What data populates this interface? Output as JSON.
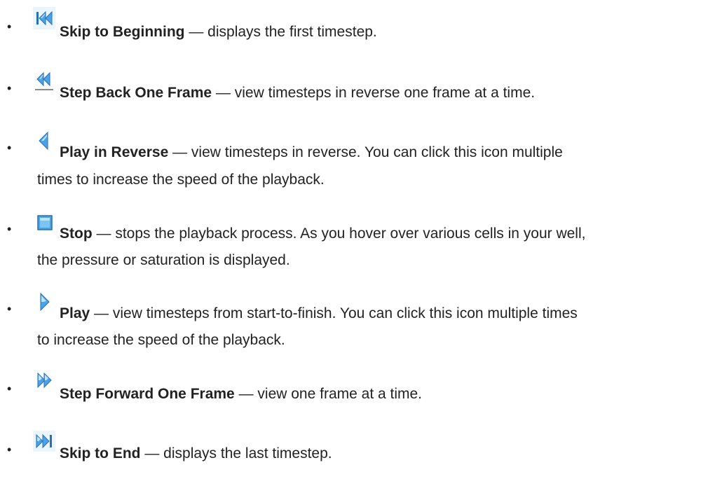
{
  "items": [
    {
      "icon": "skip-to-beginning-icon",
      "term": "Skip to Beginning",
      "desc": " — displays the first timestep.",
      "desc_cont": ""
    },
    {
      "icon": "step-back-one-frame-icon",
      "term": "Step Back One Frame",
      "desc": " — view timesteps in reverse one frame at a time.",
      "desc_cont": ""
    },
    {
      "icon": "play-in-reverse-icon",
      "term": "Play in Reverse",
      "desc": " — view timesteps in reverse. You can click this icon multiple",
      "desc_cont": "times to increase the speed of the playback."
    },
    {
      "icon": "stop-icon",
      "term": "Stop",
      "desc": " — stops the playback process. As you hover over various cells in your well,",
      "desc_cont": "the pressure or saturation is displayed."
    },
    {
      "icon": "play-icon",
      "term": "Play",
      "desc": " — view timesteps from start-to-finish. You can click this icon multiple times",
      "desc_cont": "to increase the speed of the playback."
    },
    {
      "icon": "step-forward-one-frame-icon",
      "term": "Step Forward One Frame",
      "desc": " — view one frame at a time.",
      "desc_cont": ""
    },
    {
      "icon": "skip-to-end-icon",
      "term": "Skip to End",
      "desc": " — displays the last timestep.",
      "desc_cont": ""
    }
  ],
  "bullet_char": "•",
  "colors": {
    "icon_fill": "#4aa3e6",
    "icon_dark": "#2a6fb0",
    "icon_light": "#bfe3fa",
    "text": "#222222"
  }
}
